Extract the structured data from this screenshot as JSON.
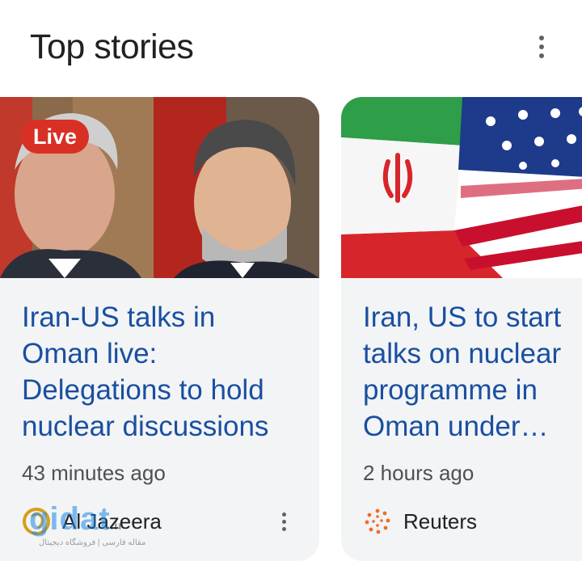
{
  "header": {
    "title": "Top stories",
    "menu_icon": "more-vert-icon"
  },
  "stories": [
    {
      "badge": "Live",
      "badge_color": "#d93025",
      "headline_lines": [
        "Iran-US talks in",
        "Oman live:",
        "Delegations to hold",
        "nuclear discussions"
      ],
      "time": "43 minutes ago",
      "source": "Al Jazeera",
      "source_icon": "al-jazeera-logo-icon",
      "menu_icon": "more-vert-icon"
    },
    {
      "headline_lines": [
        "Iran, US to start",
        "talks on nuclear",
        "programme in",
        "Oman under…"
      ],
      "time": "2 hours ago",
      "source": "Reuters",
      "source_icon": "reuters-logo-icon"
    }
  ],
  "watermark": {
    "brand": "gidat",
    "tld": ".ir",
    "tagline": "مقاله فارسی | فروشگاه دیجیتال"
  },
  "colors": {
    "headline": "#1a4fa0",
    "card_bg": "#f2f4f6",
    "title": "#202124",
    "meta": "#4d5156"
  }
}
